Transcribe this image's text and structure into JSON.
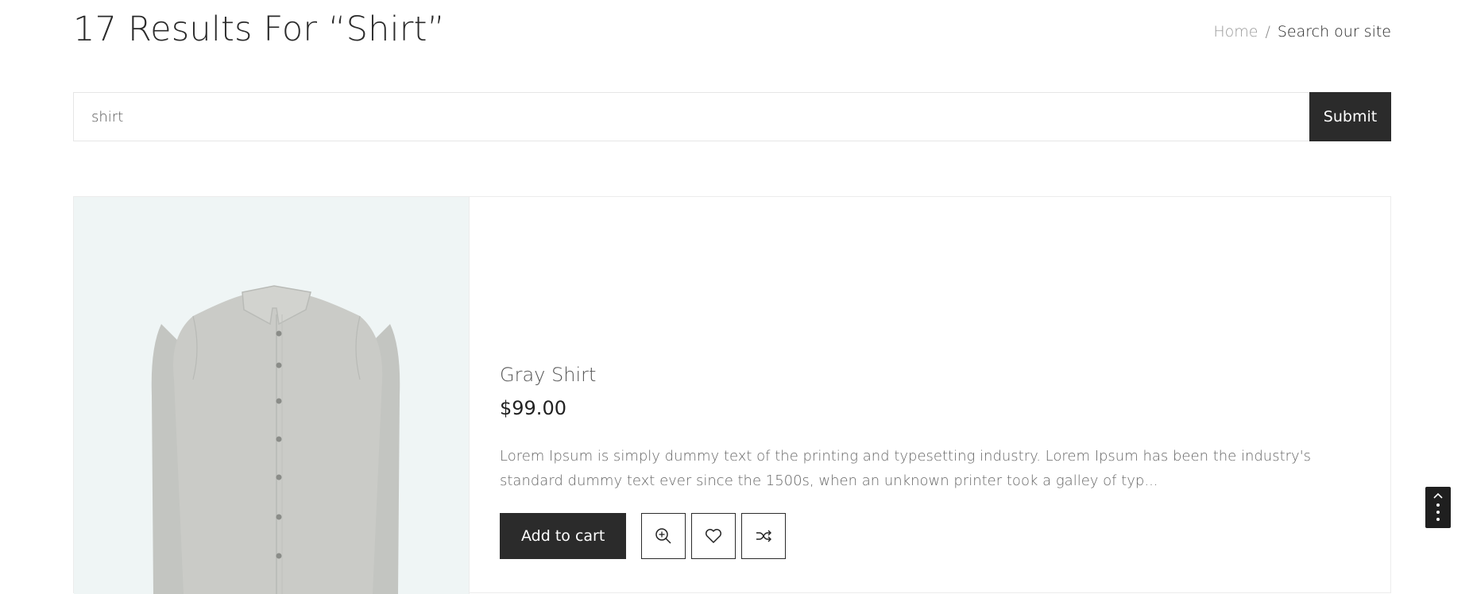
{
  "header": {
    "title": "17 Results For “Shirt”",
    "breadcrumb": {
      "home": "Home",
      "separator": "/",
      "current": "Search our site"
    }
  },
  "search": {
    "value": "shirt",
    "submit_label": "Submit"
  },
  "result": {
    "product_title": "Gray Shirt",
    "price": "$99.00",
    "description": "Lorem Ipsum is simply dummy text of the printing and typesetting industry. Lorem Ipsum has been the industry's standard dummy text ever since the 1500s, when an unknown printer took a galley of typ...",
    "add_to_cart_label": "Add to cart",
    "icons": [
      "zoom-in-icon",
      "heart-icon",
      "shuffle-icon"
    ]
  },
  "colors": {
    "accent": "#2b2b2b",
    "image_bg": "#eff5f5",
    "shirt": "#c9cbc7"
  },
  "scroll_top_icon": "chevron-up-icon"
}
